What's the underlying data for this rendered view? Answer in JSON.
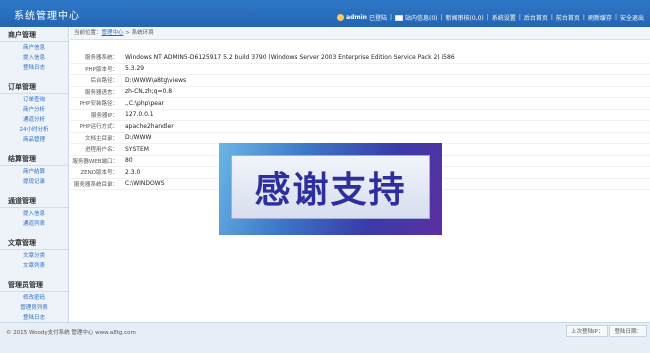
{
  "header": {
    "title": "系统管理中心",
    "user": "admin",
    "user_suffix": "已登陆",
    "nav": [
      "站内信息(0)",
      "新闻审核(0,0)",
      "系统设置",
      "后台首页",
      "前台首页",
      "刷新缓存",
      "安全退出"
    ]
  },
  "sidebar": {
    "groups": [
      {
        "title": "商户管理",
        "items": [
          "商户信息",
          "提入信息",
          "登陆日志"
        ]
      },
      {
        "title": "订单管理",
        "items": [
          "订单查询",
          "商户分析",
          "通道分析",
          "24小时分析",
          "商品管理"
        ]
      },
      {
        "title": "结算管理",
        "items": [
          "商户结算",
          "提现记录"
        ]
      },
      {
        "title": "通道管理",
        "items": [
          "提入信息",
          "通道列表"
        ]
      },
      {
        "title": "文章管理",
        "items": [
          "文章分类",
          "文章列表"
        ]
      },
      {
        "title": "管理员管理",
        "items": [
          "修改密码",
          "管理员列表",
          "登陆日志"
        ]
      }
    ]
  },
  "breadcrumb": {
    "prefix": "当前位置：",
    "link": "管理中心",
    "sep": " > ",
    "current": "系统环境"
  },
  "sysinfo": [
    {
      "label": "服务器系统：",
      "value": "Windows NT ADMIN5-D6125917 5.2 build 3790 (Windows Server 2003 Enterprise Edition Service Pack 2) i586"
    },
    {
      "label": "PHP版本号：",
      "value": "5.3.29"
    },
    {
      "label": "后台路径：",
      "value": "D:\\WWW\\a8tg\\views"
    },
    {
      "label": "服务器语言：",
      "value": "zh-CN,zh;q=0.8"
    },
    {
      "label": "PHP安装路径：",
      "value": ",,C:\\php\\pear"
    },
    {
      "label": "服务器IP：",
      "value": "127.0.0.1"
    },
    {
      "label": "PHP运行方式：",
      "value": "apache2handler"
    },
    {
      "label": "文档主目录：",
      "value": "D:/WWW"
    },
    {
      "label": "进程用户名：",
      "value": "SYSTEM"
    },
    {
      "label": "服务器WEB端口：",
      "value": "80"
    },
    {
      "label": "ZEND版本号：",
      "value": "2.3.0"
    },
    {
      "label": "服务器系统目录：",
      "value": "C:\\WINDOWS"
    }
  ],
  "banner": {
    "text": "感谢支持"
  },
  "footer": {
    "copyright": "© 2015 Woody支付系统 管理中心 www.a8tg.com",
    "last_ip": "上次登陆IP：",
    "last_time": "登陆日期："
  },
  "colors": {
    "header": "#2a6ec0",
    "sidebar": "#eef3fa",
    "link": "#2b6dc4"
  }
}
